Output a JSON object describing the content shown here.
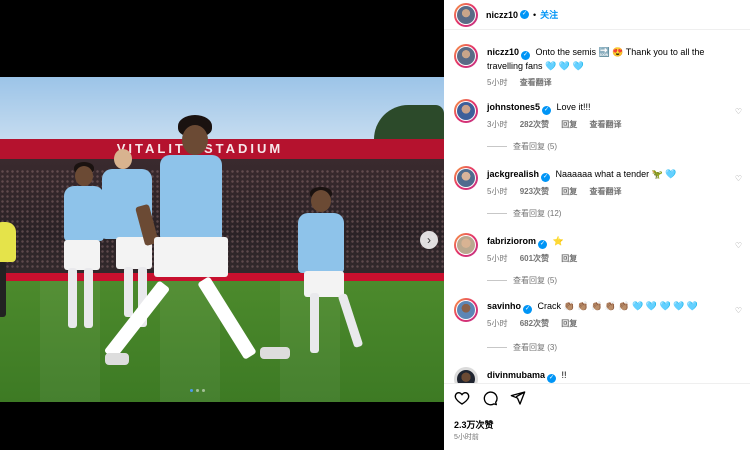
{
  "photo": {
    "stadium_text": "VITALITY STADIUM",
    "accent": "#b5122e"
  },
  "header": {
    "username": "niczz10",
    "separator": "•",
    "follow_label": "关注"
  },
  "caption": {
    "username": "niczz10",
    "text": "Onto the semis 🔜 😍 Thank you to all the travelling fans 🩵 🩵 🩵",
    "time": "5小时",
    "translate": "查看翻译"
  },
  "comments": [
    {
      "username": "johnstones5",
      "text": "Love it!!!",
      "time": "3小时",
      "likes": "282次赞",
      "reply": "回复",
      "translate": "查看翻译",
      "replies": "查看回复 (5)"
    },
    {
      "username": "jackgrealish",
      "text": "Naaaaaa what a tender 🦖 🩵",
      "time": "5小时",
      "likes": "923次赞",
      "reply": "回复",
      "translate": "查看翻译",
      "replies": "查看回复 (12)"
    },
    {
      "username": "fabriziorom",
      "text": "⭐",
      "time": "5小时",
      "likes": "601次赞",
      "reply": "回复",
      "replies": "查看回复 (5)"
    },
    {
      "username": "savinho",
      "text": "Crack 👏🏽 👏🏽 👏🏽 👏🏽 👏🏽 🩵 🩵 🩵 🩵 🩵",
      "time": "5小时",
      "likes": "682次赞",
      "reply": "回复",
      "replies": "查看回复 (3)"
    },
    {
      "username": "divinmubama",
      "text": "!!"
    }
  ],
  "actions": {
    "likes": "2.3万次赞",
    "time": "5小时前"
  },
  "colors": {
    "verified": "#0095f6",
    "link": "#0095f6",
    "muted": "#737373",
    "shirt": "#8ec3ea"
  },
  "icons": [
    "heart-icon",
    "comment-icon",
    "share-icon",
    "chevron-right-icon",
    "verified-icon"
  ]
}
